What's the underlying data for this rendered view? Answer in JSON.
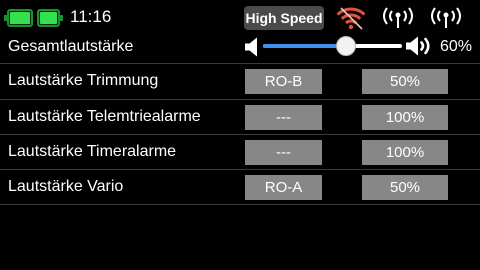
{
  "status_bar": {
    "time": "11:16",
    "mode": "High Speed",
    "batteries": [
      {
        "icon": "battery-icon",
        "level": 1
      },
      {
        "icon": "battery-icon",
        "level": 1
      }
    ],
    "wifi_icon": "wifi-off-icon",
    "antenna_icons": [
      "antenna-signal-icon",
      "antenna-signal-icon"
    ]
  },
  "master_volume": {
    "label": "Gesamtlautstärke",
    "value": "60%",
    "level": 0.6,
    "icon_low": "volume-low-icon",
    "icon_high": "volume-high-icon"
  },
  "rows": [
    {
      "label": "Lautstärke Trimmung",
      "source": "RO-B",
      "value": "50%"
    },
    {
      "label": "Lautstärke Telemtriealarme",
      "source": "---",
      "value": "100%"
    },
    {
      "label": "Lautstärke Timeralarme",
      "source": "---",
      "value": "100%"
    },
    {
      "label": "Lautstärke Vario",
      "source": "RO-A",
      "value": "50%"
    }
  ],
  "colors": {
    "background": "#000000",
    "text": "#ffffff",
    "battery_fill": "#35e04f",
    "battery_outline": "#1c8f32",
    "slider_fill": "#3f8ff0",
    "slider_track": "#ffffff",
    "field_box": "#878787",
    "mode_badge": "#4b4b4b",
    "wifi_icon": "#e0533c",
    "separator": "#3a3a3a"
  }
}
